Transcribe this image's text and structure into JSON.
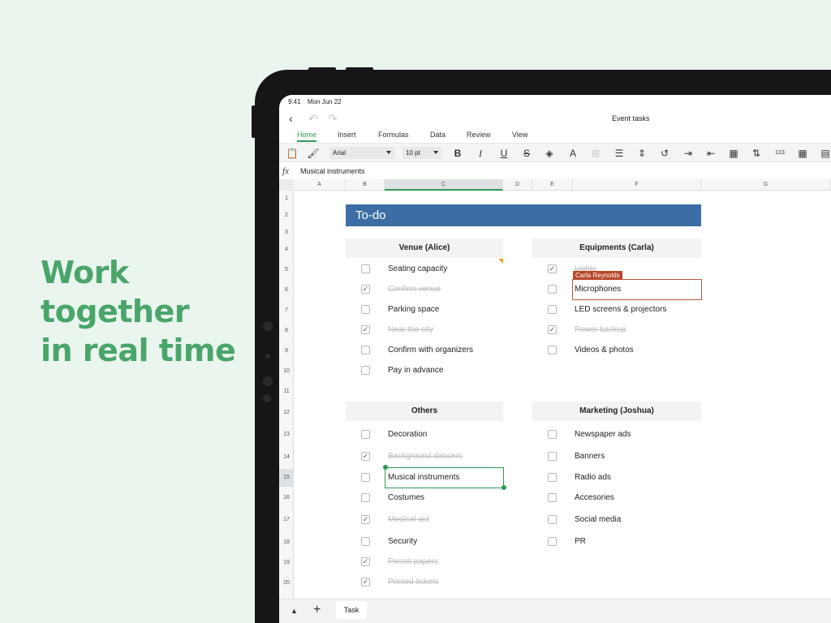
{
  "promo": {
    "lines": [
      "Work",
      "together",
      "in real time"
    ]
  },
  "status": {
    "time": "9:41",
    "date": "Mon Jun 22"
  },
  "document": {
    "title": "Event tasks"
  },
  "tabs": [
    {
      "label": "Home",
      "active": true
    },
    {
      "label": "Insert"
    },
    {
      "label": "Formulas"
    },
    {
      "label": "Data"
    },
    {
      "label": "Review"
    },
    {
      "label": "View"
    }
  ],
  "toolbar": {
    "font": "Arial",
    "font_size": "10 pt",
    "bold": "B",
    "italic": "I",
    "underline": "U",
    "strike": "S"
  },
  "formula_bar": {
    "fx": "fx",
    "value": "Musical instruments"
  },
  "columns": [
    "A",
    "B",
    "C",
    "D",
    "E",
    "F",
    "G"
  ],
  "rows": [
    "1",
    "2",
    "3",
    "4",
    "5",
    "6",
    "7",
    "8",
    "9",
    "10",
    "11",
    "12",
    "13",
    "14",
    "15",
    "16",
    "17",
    "18",
    "19",
    "20"
  ],
  "sheet": {
    "banner": "To-do",
    "venue": {
      "header": "Venue (Alice)",
      "items": [
        {
          "text": "Seating capacity",
          "done": false
        },
        {
          "text": "Confirm venue",
          "done": true
        },
        {
          "text": "Parking space",
          "done": false
        },
        {
          "text": "Near the city",
          "done": true
        },
        {
          "text": "Confirm with organizers",
          "done": false
        },
        {
          "text": "Pay in advance",
          "done": false
        }
      ]
    },
    "equipments": {
      "header": "Equipments (Carla)",
      "items": [
        {
          "text": "Lights",
          "done": true
        },
        {
          "text": "Microphones",
          "done": false
        },
        {
          "text": "LED screens & projectors",
          "done": false
        },
        {
          "text": "Power backup",
          "done": true
        },
        {
          "text": "Videos & photos",
          "done": false
        }
      ]
    },
    "others": {
      "header": "Others",
      "items": [
        {
          "text": "Decoration",
          "done": false
        },
        {
          "text": "Background dancers",
          "done": true
        },
        {
          "text": "Musical instruments",
          "done": false
        },
        {
          "text": "Costumes",
          "done": false
        },
        {
          "text": "Medical aid",
          "done": true
        },
        {
          "text": "Security",
          "done": false
        },
        {
          "text": "Permit papers",
          "done": true
        },
        {
          "text": "Printed tickets",
          "done": true
        }
      ]
    },
    "marketing": {
      "header": "Marketing (Joshua)",
      "items": [
        {
          "text": "Newspaper ads",
          "done": false
        },
        {
          "text": "Banners",
          "done": false
        },
        {
          "text": "Radio ads",
          "done": false
        },
        {
          "text": "Accesories",
          "done": false
        },
        {
          "text": "Social media",
          "done": false
        },
        {
          "text": "PR",
          "done": false
        }
      ]
    },
    "collaborator": "Carla Reynolds",
    "check_mark": "✓"
  },
  "bottom": {
    "sheet_tab": "Task"
  },
  "colors": {
    "accent": "#2e9a57",
    "banner": "#3c6ea5",
    "collaborator": "#b8472a",
    "promo": "#4aa56b"
  }
}
